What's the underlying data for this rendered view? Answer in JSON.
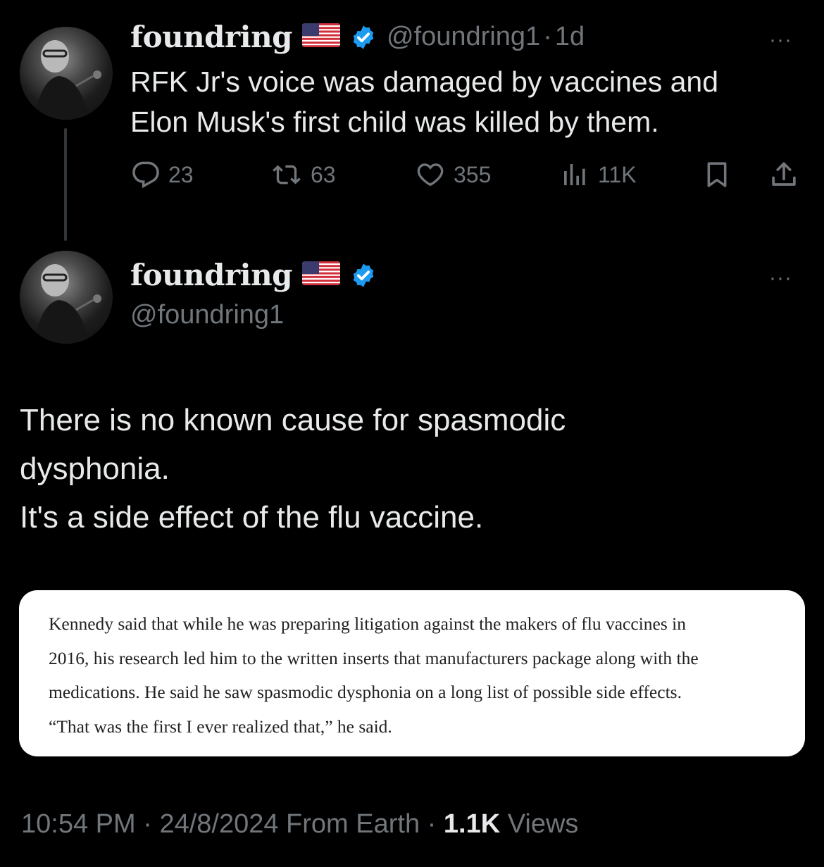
{
  "parent_tweet": {
    "display_name": "foundring",
    "flag_icon": "us-flag-icon",
    "verified_color": "#1d9bf0",
    "handle": "@foundring1",
    "separator": "·",
    "time": "1d",
    "more_label": "···",
    "text_line1": "RFK Jr's voice was damaged by vaccines and",
    "text_line2": "Elon Musk's first child was killed by them.",
    "actions": {
      "replies": "23",
      "retweets": "63",
      "likes": "355",
      "views": "11K"
    }
  },
  "main_tweet": {
    "display_name": "foundring",
    "handle": "@foundring1",
    "more_label": "···",
    "text_line1": "There is no known cause for spasmodic",
    "text_line2": "dysphonia.",
    "text_line3": "It's a side effect of the flu vaccine.",
    "quote_image_text": {
      "line1": "Kennedy said that while he was preparing litigation against the makers of flu vaccines in",
      "line2": "2016, his research led him to the written inserts that manufacturers package along with the",
      "line3": "medications. He said he saw spasmodic dysphonia on a long list of possible side effects.",
      "line4": "“That was the first I ever realized that,” he said."
    },
    "footer": {
      "time": "10:54 PM",
      "sep1": " · ",
      "date": "24/8/2024",
      "location": " From Earth",
      "sep2": " · ",
      "views_count": "1.1K",
      "views_label": " Views"
    }
  },
  "colors": {
    "background": "#000000",
    "text_primary": "#e7e9ea",
    "text_secondary": "#71767b",
    "verified": "#1d9bf0"
  }
}
